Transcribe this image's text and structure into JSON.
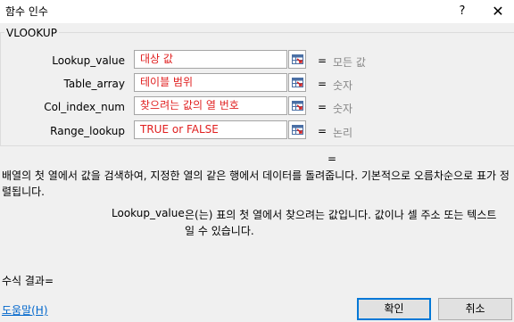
{
  "window": {
    "title": "함수 인수",
    "help_glyph": "?",
    "close_glyph": "✕"
  },
  "group": {
    "title": "VLOOKUP"
  },
  "arguments": [
    {
      "label": "Lookup_value",
      "value": "대상 값",
      "result": "모든 값"
    },
    {
      "label": "Table_array",
      "value": "테이블 범위",
      "result": "숫자"
    },
    {
      "label": "Col_index_num",
      "value": "찾으려는 값의 열 번호",
      "result": "숫자"
    },
    {
      "label": "Range_lookup",
      "value": "TRUE or FALSE",
      "result": "논리"
    }
  ],
  "equals_sign": "=",
  "function_result_eq": "=",
  "description": "배열의 첫 열에서 값을 검색하여, 지정한 열의 같은 행에서 데이터를 돌려줍니다. 기본적으로 오름차순으로 표가 정렬됩니다.",
  "arg_description": {
    "name": "Lookup_value",
    "text": "은(는) 표의 첫 열에서 찾으려는 값입니다. 값이나 셀 주소 또는 텍스트일 수 있습니다."
  },
  "formula_result": "수식 결과=",
  "help_link": "도움말(H)",
  "buttons": {
    "ok": "확인",
    "cancel": "취소"
  },
  "colors": {
    "input_text": "#e02020",
    "result_text": "#888888",
    "ok_border": "#0078d7",
    "link": "#0066cc"
  }
}
